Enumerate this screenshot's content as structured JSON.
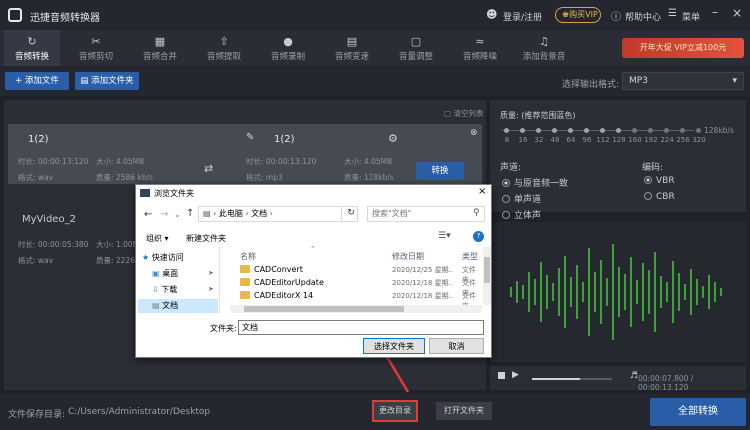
{
  "app": {
    "title": "迅捷音频转换器",
    "login": "登录/注册",
    "vip": "购买VIP",
    "help": "帮助中心",
    "menu": "菜单"
  },
  "tabs": [
    {
      "label": "音频转换",
      "icon": "convert-icon"
    },
    {
      "label": "音频剪切",
      "icon": "scissors-icon"
    },
    {
      "label": "音频合并",
      "icon": "merge-icon"
    },
    {
      "label": "音频提取",
      "icon": "extract-icon"
    },
    {
      "label": "音频录制",
      "icon": "mic-icon"
    },
    {
      "label": "音频变速",
      "icon": "speed-icon"
    },
    {
      "label": "音量调整",
      "icon": "volume-icon"
    },
    {
      "label": "音频降噪",
      "icon": "denoise-icon"
    },
    {
      "label": "添加背景音",
      "icon": "bgm-icon"
    }
  ],
  "promo": "开年大促 VIP立减100元",
  "actions": {
    "add_file": "添加文件",
    "add_folder": "添加文件夹",
    "output_format_label": "选择输出格式:",
    "output_format": "MP3",
    "clear_list": "清空列表"
  },
  "files": [
    {
      "name": "1(2)",
      "out_name": "1(2)",
      "duration": "时长: 00:00:13:120",
      "size": "大小: 4.05MB",
      "format": "格式: wav",
      "quality": "质量: 2586 kb/s",
      "out_duration": "时长: 00:00:13:120",
      "out_size": "大小: 4.05MB",
      "out_format": "格式: mp3",
      "out_quality": "质量: 128kb/s",
      "convert": "转换"
    },
    {
      "name": "MyVideo_2",
      "duration": "时长: 00:00:05:380",
      "size": "大小: 1.00MB",
      "format": "格式: wav",
      "quality": "质量: 2226"
    }
  ],
  "settings": {
    "quality_label": "质量: (推荐范围蓝色)",
    "quality_value": "128kb/s",
    "quality_ticks": [
      "8",
      "16",
      "32",
      "48",
      "64",
      "96",
      "112",
      "128",
      "160",
      "192",
      "224",
      "256",
      "320"
    ],
    "channel_label": "声道:",
    "channels": [
      "与原音频一致",
      "单声道",
      "立体声"
    ],
    "encoding_label": "编码:",
    "encodings": [
      "VBR",
      "CBR"
    ]
  },
  "player": {
    "time": "00:00:07.800 / 00:00:13.120"
  },
  "footer": {
    "save_dir_label": "文件保存目录:",
    "save_dir": "C:/Users/Administrator/Desktop",
    "change_dir": "更改目录",
    "open_folder": "打开文件夹",
    "convert_all": "全部转换"
  },
  "dialog": {
    "title": "浏览文件夹",
    "path": [
      "此电脑",
      "文档"
    ],
    "search_placeholder": "搜索\"文档\"",
    "organize": "组织 ▾",
    "new_folder": "新建文件夹",
    "tree": [
      "快速访问",
      "桌面",
      "下载",
      "文档"
    ],
    "col_name": "名称",
    "col_date": "修改日期",
    "col_type": "类型",
    "rows": [
      {
        "name": "CADConvert",
        "date": "2020/12/25 星期..",
        "type": "文件夹"
      },
      {
        "name": "CADEditorUpdate",
        "date": "2020/12/18 星期..",
        "type": "文件夹"
      },
      {
        "name": "CADEditorX 14",
        "date": "2020/12/18 星期..",
        "type": "文件夹"
      }
    ],
    "folder_label": "文件夹:",
    "folder_value": "文档",
    "select_btn": "选择文件夹",
    "cancel_btn": "取消"
  },
  "colors": {
    "accent": "#2a5ea8",
    "highlight": "#e53935",
    "wave": "#3fa03a"
  }
}
